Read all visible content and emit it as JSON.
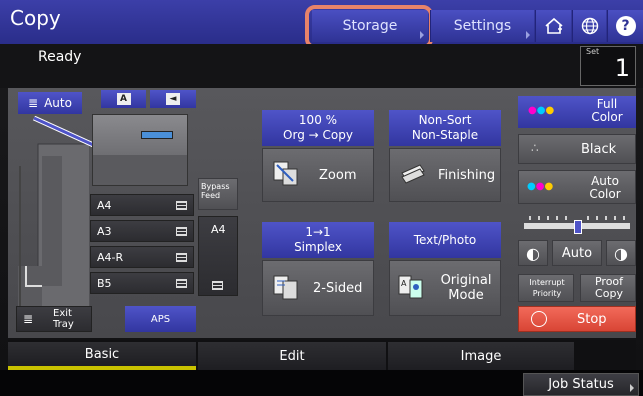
{
  "header": {
    "title": "Copy",
    "storage_label": "Storage",
    "settings_label": "Settings"
  },
  "status": {
    "ready": "Ready",
    "set_label": "Set",
    "set_value": "1"
  },
  "paper": {
    "auto_label": "Auto",
    "doc_a_label": "A",
    "trays": [
      {
        "size": "A4"
      },
      {
        "size": "A3"
      },
      {
        "size": "A4-R"
      },
      {
        "size": "B5"
      }
    ],
    "bypass_label": "Bypass Feed",
    "bypass_size": "A4",
    "exit_tray_label": "Exit Tray",
    "aps_label": "APS"
  },
  "functions": {
    "zoom_info": "100 %\nOrg → Copy",
    "zoom_label": "Zoom",
    "finishing_info": "Non-Sort\nNon-Staple",
    "finishing_label": "Finishing",
    "sided_info": "1→1\nSimplex",
    "sided_label": "2-Sided",
    "mode_info": "Text/Photo",
    "mode_label": "Original\nMode"
  },
  "color": {
    "full_color": "Full\nColor",
    "black": "Black",
    "auto_color": "Auto\nColor",
    "density_auto": "Auto",
    "density_level": 0.5
  },
  "actions": {
    "interrupt": "Interrupt\nPriority",
    "proof_copy": "Proof\nCopy",
    "stop": "Stop"
  },
  "tabs": [
    "Basic",
    "Edit",
    "Image"
  ],
  "job_status": "Job Status",
  "colors": {
    "accent_blue": "#3a3fb0",
    "highlight": "#e8836a",
    "stop_red": "#e05040",
    "tab_active": "#c9c200"
  }
}
